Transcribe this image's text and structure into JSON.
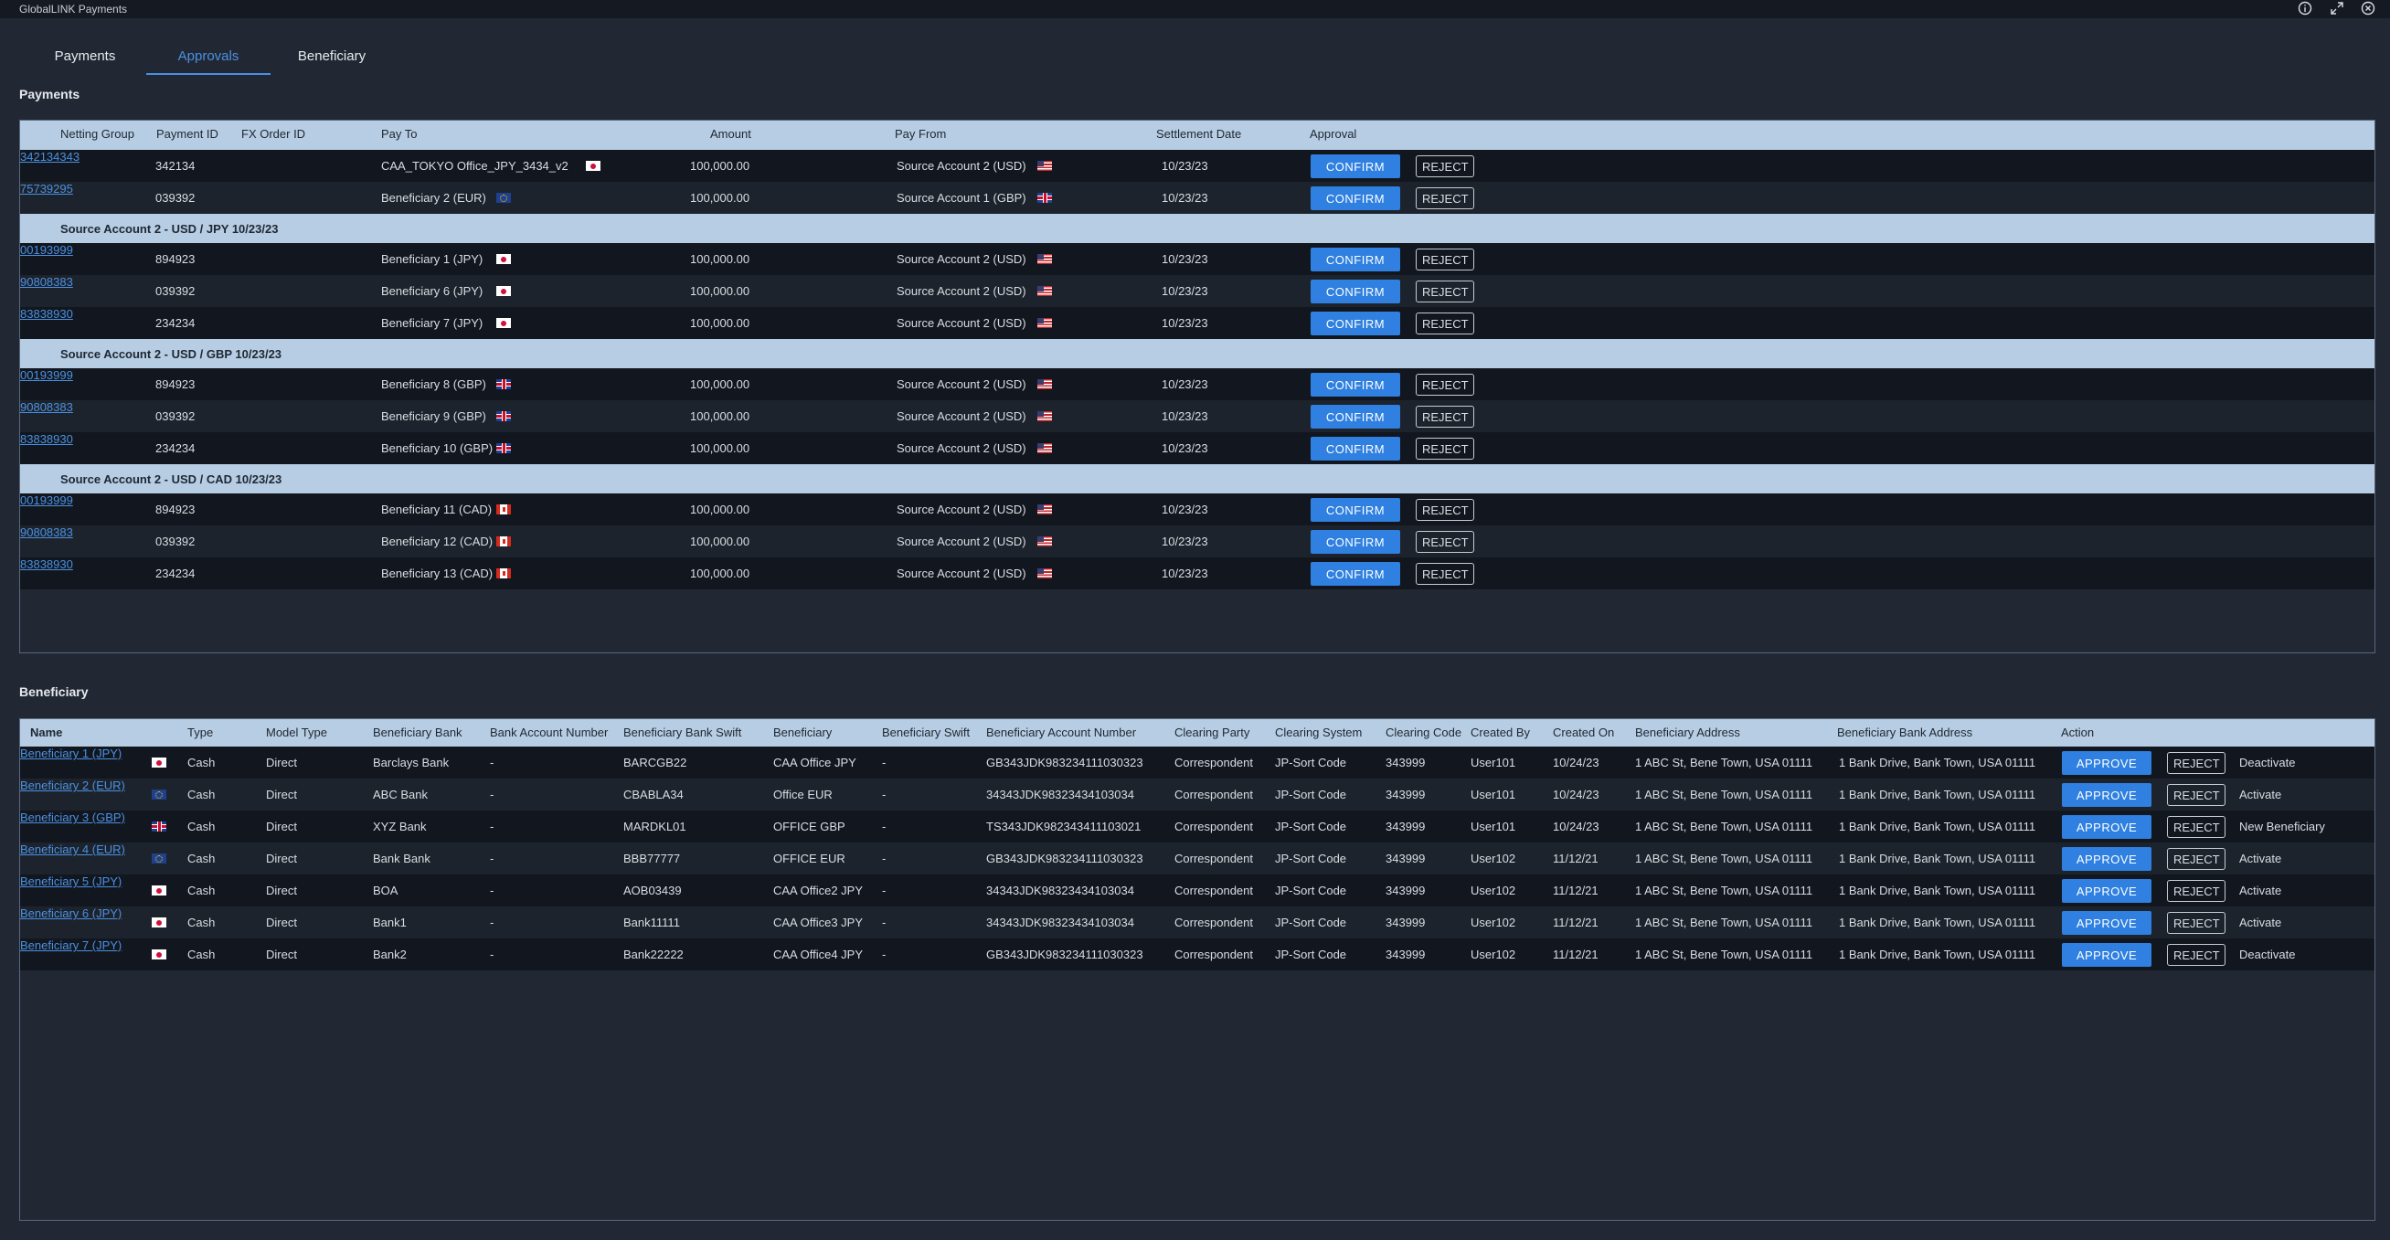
{
  "app": {
    "title": "GlobalLINK Payments",
    "icons": [
      "info-icon",
      "expand-icon",
      "close-icon"
    ]
  },
  "tabs": [
    {
      "label": "Payments",
      "active": false
    },
    {
      "label": "Approvals",
      "active": true
    },
    {
      "label": "Beneficiary",
      "active": false
    }
  ],
  "payments": {
    "section_title": "Payments",
    "columns": [
      "Netting Group",
      "Payment ID",
      "FX Order ID",
      "Pay To",
      "Amount",
      "Pay From",
      "Settlement Date",
      "Approval"
    ],
    "confirm_label": "CONFIRM",
    "reject_label": "REJECT",
    "rows": [
      {
        "payment_id": "342134",
        "fx_order_id": "342134343",
        "pay_to": "CAA_TOKYO Office_JPY_3434_v2",
        "pay_to_flag": "jp",
        "amount": "100,000.00",
        "pay_from": "Source Account 2 (USD)",
        "pay_from_flag": "us",
        "settlement_date": "10/23/23"
      },
      {
        "payment_id": "039392",
        "fx_order_id": "75739295",
        "pay_to": "Beneficiary 2 (EUR)",
        "pay_to_flag": "eu",
        "amount": "100,000.00",
        "pay_from": "Source Account 1 (GBP)",
        "pay_from_flag": "gb",
        "settlement_date": "10/23/23"
      }
    ],
    "groups": [
      {
        "label": "Source Account 2 - USD / JPY 10/23/23",
        "rows": [
          {
            "payment_id": "894923",
            "fx_order_id": "00193999",
            "pay_to": "Beneficiary 1 (JPY)",
            "pay_to_flag": "jp",
            "amount": "100,000.00",
            "pay_from": "Source Account 2 (USD)",
            "pay_from_flag": "us",
            "settlement_date": "10/23/23"
          },
          {
            "payment_id": "039392",
            "fx_order_id": "90808383",
            "pay_to": "Beneficiary 6 (JPY)",
            "pay_to_flag": "jp",
            "amount": "100,000.00",
            "pay_from": "Source Account 2 (USD)",
            "pay_from_flag": "us",
            "settlement_date": "10/23/23"
          },
          {
            "payment_id": "234234",
            "fx_order_id": "83838930",
            "pay_to": "Beneficiary 7 (JPY)",
            "pay_to_flag": "jp",
            "amount": "100,000.00",
            "pay_from": "Source Account 2 (USD)",
            "pay_from_flag": "us",
            "settlement_date": "10/23/23"
          }
        ]
      },
      {
        "label": "Source Account 2 - USD / GBP 10/23/23",
        "rows": [
          {
            "payment_id": "894923",
            "fx_order_id": "00193999",
            "pay_to": "Beneficiary 8 (GBP)",
            "pay_to_flag": "gb",
            "amount": "100,000.00",
            "pay_from": "Source Account 2 (USD)",
            "pay_from_flag": "us",
            "settlement_date": "10/23/23"
          },
          {
            "payment_id": "039392",
            "fx_order_id": "90808383",
            "pay_to": "Beneficiary 9 (GBP)",
            "pay_to_flag": "gb",
            "amount": "100,000.00",
            "pay_from": "Source Account 2 (USD)",
            "pay_from_flag": "us",
            "settlement_date": "10/23/23"
          },
          {
            "payment_id": "234234",
            "fx_order_id": "83838930",
            "pay_to": "Beneficiary 10 (GBP)",
            "pay_to_flag": "gb",
            "amount": "100,000.00",
            "pay_from": "Source Account 2 (USD)",
            "pay_from_flag": "us",
            "settlement_date": "10/23/23"
          }
        ]
      },
      {
        "label": "Source Account 2 - USD / CAD 10/23/23",
        "rows": [
          {
            "payment_id": "894923",
            "fx_order_id": "00193999",
            "pay_to": "Beneficiary 11 (CAD)",
            "pay_to_flag": "ca",
            "amount": "100,000.00",
            "pay_from": "Source Account 2 (USD)",
            "pay_from_flag": "us",
            "settlement_date": "10/23/23"
          },
          {
            "payment_id": "039392",
            "fx_order_id": "90808383",
            "pay_to": "Beneficiary 12 (CAD)",
            "pay_to_flag": "ca",
            "amount": "100,000.00",
            "pay_from": "Source Account 2 (USD)",
            "pay_from_flag": "us",
            "settlement_date": "10/23/23"
          },
          {
            "payment_id": "234234",
            "fx_order_id": "83838930",
            "pay_to": "Beneficiary 13 (CAD)",
            "pay_to_flag": "ca",
            "amount": "100,000.00",
            "pay_from": "Source Account 2 (USD)",
            "pay_from_flag": "us",
            "settlement_date": "10/23/23"
          }
        ]
      }
    ]
  },
  "beneficiary": {
    "section_title": "Beneficiary",
    "columns": [
      "Name",
      "Type",
      "Model Type",
      "Beneficiary Bank",
      "Bank Account Number",
      "Beneficiary Bank Swift",
      "Beneficiary",
      "Beneficiary Swift",
      "Beneficiary Account Number",
      "Clearing Party",
      "Clearing System",
      "Clearing Code",
      "Created By",
      "Created On",
      "Beneficiary Address",
      "Beneficiary Bank Address",
      "Action"
    ],
    "approve_label": "APPROVE",
    "reject_label": "REJECT",
    "rows": [
      {
        "name": "Beneficiary 1 (JPY)",
        "flag": "jp",
        "type": "Cash",
        "model_type": "Direct",
        "bank": "Barclays Bank",
        "account_number": "-",
        "bank_swift": "BARCGB22",
        "beneficiary": "CAA Office JPY",
        "swift": "-",
        "beneficiary_account": "GB343JDK983234111030323",
        "clearing_party": "Correspondent",
        "clearing_system": "JP-Sort Code",
        "clearing_code": "343999",
        "created_by": "User101",
        "created_on": "10/24/23",
        "address": "1 ABC St, Bene Town, USA 01111",
        "bank_address": "1 Bank Drive, Bank Town, USA 01111",
        "status": "Deactivate"
      },
      {
        "name": "Beneficiary 2 (EUR)",
        "flag": "eu",
        "type": "Cash",
        "model_type": "Direct",
        "bank": "ABC Bank",
        "account_number": "-",
        "bank_swift": "CBABLA34",
        "beneficiary": "Office EUR",
        "swift": "-",
        "beneficiary_account": "34343JDK98323434103034",
        "clearing_party": "Correspondent",
        "clearing_system": "JP-Sort Code",
        "clearing_code": "343999",
        "created_by": "User101",
        "created_on": "10/24/23",
        "address": "1 ABC St, Bene Town, USA 01111",
        "bank_address": "1 Bank Drive, Bank Town, USA 01111",
        "status": "Activate"
      },
      {
        "name": "Beneficiary 3 (GBP)",
        "flag": "gb",
        "type": "Cash",
        "model_type": "Direct",
        "bank": "XYZ Bank",
        "account_number": "-",
        "bank_swift": "MARDKL01",
        "beneficiary": "OFFICE GBP",
        "swift": "-",
        "beneficiary_account": "TS343JDK982343411103021",
        "clearing_party": "Correspondent",
        "clearing_system": "JP-Sort Code",
        "clearing_code": "343999",
        "created_by": "User101",
        "created_on": "10/24/23",
        "address": "1 ABC St, Bene Town, USA 01111",
        "bank_address": "1 Bank Drive, Bank Town, USA 01111",
        "status": "New Beneficiary"
      },
      {
        "name": "Beneficiary 4 (EUR)",
        "flag": "eu",
        "type": "Cash",
        "model_type": "Direct",
        "bank": "Bank Bank",
        "account_number": "-",
        "bank_swift": "BBB77777",
        "beneficiary": "OFFICE EUR",
        "swift": "-",
        "beneficiary_account": "GB343JDK983234111030323",
        "clearing_party": "Correspondent",
        "clearing_system": "JP-Sort Code",
        "clearing_code": "343999",
        "created_by": "User102",
        "created_on": "11/12/21",
        "address": "1 ABC St, Bene Town, USA 01111",
        "bank_address": "1 Bank Drive, Bank Town, USA 01111",
        "status": "Activate"
      },
      {
        "name": "Beneficiary 5 (JPY)",
        "flag": "jp",
        "type": "Cash",
        "model_type": "Direct",
        "bank": "BOA",
        "account_number": "-",
        "bank_swift": "AOB03439",
        "beneficiary": "CAA Office2 JPY",
        "swift": "-",
        "beneficiary_account": "34343JDK98323434103034",
        "clearing_party": "Correspondent",
        "clearing_system": "JP-Sort Code",
        "clearing_code": "343999",
        "created_by": "User102",
        "created_on": "11/12/21",
        "address": "1 ABC St, Bene Town, USA 01111",
        "bank_address": "1 Bank Drive, Bank Town, USA 01111",
        "status": "Activate"
      },
      {
        "name": "Beneficiary 6 (JPY)",
        "flag": "jp",
        "type": "Cash",
        "model_type": "Direct",
        "bank": "Bank1",
        "account_number": "-",
        "bank_swift": "Bank11111",
        "beneficiary": "CAA Office3 JPY",
        "swift": "-",
        "beneficiary_account": "34343JDK98323434103034",
        "clearing_party": "Correspondent",
        "clearing_system": "JP-Sort Code",
        "clearing_code": "343999",
        "created_by": "User102",
        "created_on": "11/12/21",
        "address": "1 ABC St, Bene Town, USA 01111",
        "bank_address": "1 Bank Drive, Bank Town, USA 01111",
        "status": "Activate"
      },
      {
        "name": "Beneficiary 7 (JPY)",
        "flag": "jp",
        "type": "Cash",
        "model_type": "Direct",
        "bank": "Bank2",
        "account_number": "-",
        "bank_swift": "Bank22222",
        "beneficiary": "CAA Office4 JPY",
        "swift": "-",
        "beneficiary_account": "GB343JDK983234111030323",
        "clearing_party": "Correspondent",
        "clearing_system": "JP-Sort Code",
        "clearing_code": "343999",
        "created_by": "User102",
        "created_on": "11/12/21",
        "address": "1 ABC St, Bene Town, USA 01111",
        "bank_address": "1 Bank Drive, Bank Town, USA 01111",
        "status": "Deactivate"
      }
    ]
  },
  "colors": {
    "background": "#222833",
    "header_band": "#b7cde3",
    "accent": "#2f80e0",
    "link": "#4a90e2"
  }
}
